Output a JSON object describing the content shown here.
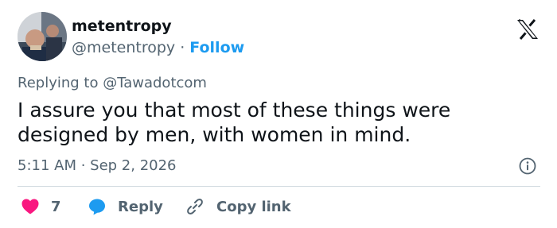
{
  "user": {
    "display_name": "metentropy",
    "handle": "@metentropy",
    "separator": " · ",
    "follow_label": "Follow"
  },
  "reply_context": {
    "prefix": "Replying to ",
    "target": "@Tawadotcom",
    "full": "Replying to @Tawadotcom"
  },
  "tweet": {
    "text": "I assure you that most of these things were designed by men, with women in mind."
  },
  "meta": {
    "timestamp": "5:11 AM · Sep 2, 2026"
  },
  "actions": {
    "like_count": "7",
    "reply_label": "Reply",
    "copy_label": "Copy link"
  },
  "colors": {
    "like": "#f91880",
    "reply": "#1d9bf0",
    "follow": "#1d9bf0",
    "muted": "#536471",
    "text": "#0f1419"
  },
  "icons": [
    "x-logo-icon",
    "info-icon",
    "heart-icon",
    "reply-bubble-icon",
    "link-icon"
  ]
}
